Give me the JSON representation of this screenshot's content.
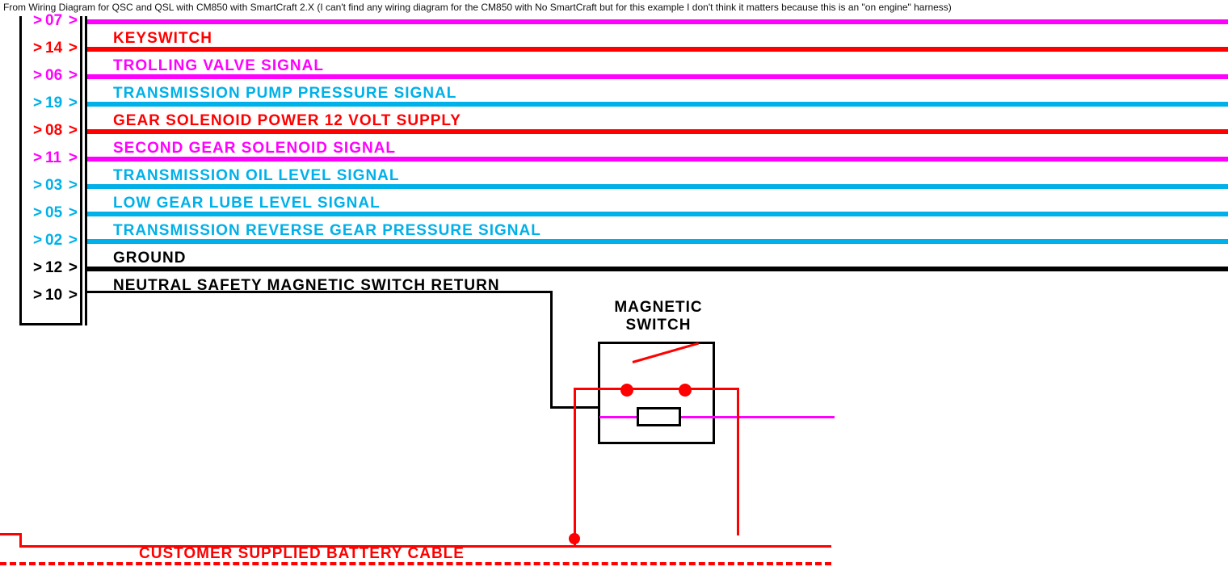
{
  "caption": "From Wiring Diagram for QSC and QSL with CM850 with SmartCraft 2.X (I can't find any wiring diagram for the CM850 with No SmartCraft but for this example I don't think it matters because this is an \"on engine\" harness)",
  "colors": {
    "red": "#ff0000",
    "magenta": "#ff00ff",
    "cyan": "#00b0e8",
    "black": "#000000"
  },
  "connector": {
    "pins": [
      {
        "num": "07",
        "color": "magenta"
      },
      {
        "num": "14",
        "color": "red"
      },
      {
        "num": "06",
        "color": "magenta"
      },
      {
        "num": "19",
        "color": "cyan"
      },
      {
        "num": "08",
        "color": "red"
      },
      {
        "num": "11",
        "color": "magenta"
      },
      {
        "num": "03",
        "color": "cyan"
      },
      {
        "num": "05",
        "color": "cyan"
      },
      {
        "num": "02",
        "color": "cyan"
      },
      {
        "num": "12",
        "color": "black"
      },
      {
        "num": "10",
        "color": "black"
      }
    ]
  },
  "signals": [
    {
      "pin": "07",
      "label": "",
      "color": "magenta",
      "has_label": false
    },
    {
      "pin": "14",
      "label": "KEYSWITCH",
      "color": "red",
      "has_label": true
    },
    {
      "pin": "06",
      "label": "TROLLING  VALVE  SIGNAL",
      "color": "magenta",
      "has_label": true
    },
    {
      "pin": "19",
      "label": "TRANSMISSION  PUMP  PRESSURE  SIGNAL",
      "color": "cyan",
      "has_label": true
    },
    {
      "pin": "08",
      "label": "GEAR  SOLENOID  POWER  12  VOLT  SUPPLY",
      "color": "red",
      "has_label": true
    },
    {
      "pin": "11",
      "label": "SECOND  GEAR  SOLENOID  SIGNAL",
      "color": "magenta",
      "has_label": true
    },
    {
      "pin": "03",
      "label": "TRANSMISSION  OIL  LEVEL  SIGNAL",
      "color": "cyan",
      "has_label": true
    },
    {
      "pin": "05",
      "label": "LOW  GEAR  LUBE  LEVEL  SIGNAL",
      "color": "cyan",
      "has_label": true
    },
    {
      "pin": "02",
      "label": "TRANSMISSION  REVERSE  GEAR  PRESSURE  SIGNAL",
      "color": "cyan",
      "has_label": true
    },
    {
      "pin": "12",
      "label": "GROUND",
      "color": "black",
      "has_label": true
    },
    {
      "pin": "10",
      "label": "NEUTRAL  SAFETY  MAGNETIC  SWITCH  RETURN",
      "color": "black",
      "has_label": true
    }
  ],
  "magnetic_switch": {
    "title_l1": "MAGNETIC",
    "title_l2": "SWITCH"
  },
  "battery_cable": {
    "label": "CUSTOMER  SUPPLIED  BATTERY  CABLE"
  }
}
